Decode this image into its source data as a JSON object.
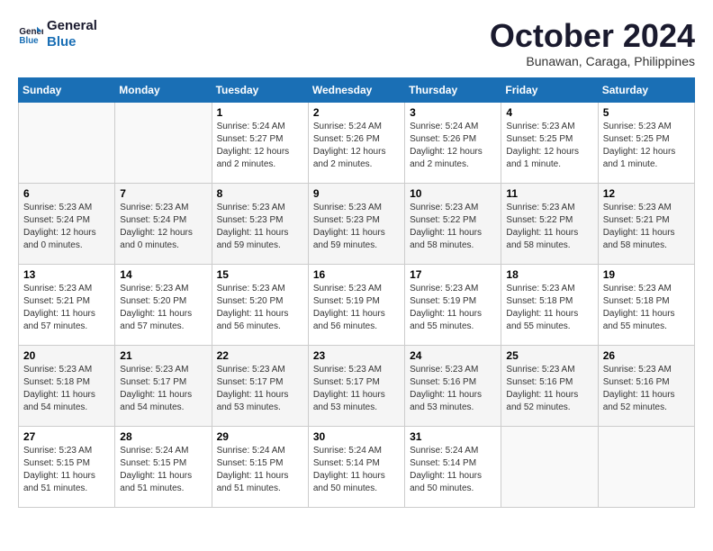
{
  "logo": {
    "line1": "General",
    "line2": "Blue"
  },
  "title": "October 2024",
  "location": "Bunawan, Caraga, Philippines",
  "headers": [
    "Sunday",
    "Monday",
    "Tuesday",
    "Wednesday",
    "Thursday",
    "Friday",
    "Saturday"
  ],
  "weeks": [
    [
      {
        "day": "",
        "info": ""
      },
      {
        "day": "",
        "info": ""
      },
      {
        "day": "1",
        "info": "Sunrise: 5:24 AM\nSunset: 5:27 PM\nDaylight: 12 hours and 2 minutes."
      },
      {
        "day": "2",
        "info": "Sunrise: 5:24 AM\nSunset: 5:26 PM\nDaylight: 12 hours and 2 minutes."
      },
      {
        "day": "3",
        "info": "Sunrise: 5:24 AM\nSunset: 5:26 PM\nDaylight: 12 hours and 2 minutes."
      },
      {
        "day": "4",
        "info": "Sunrise: 5:23 AM\nSunset: 5:25 PM\nDaylight: 12 hours and 1 minute."
      },
      {
        "day": "5",
        "info": "Sunrise: 5:23 AM\nSunset: 5:25 PM\nDaylight: 12 hours and 1 minute."
      }
    ],
    [
      {
        "day": "6",
        "info": "Sunrise: 5:23 AM\nSunset: 5:24 PM\nDaylight: 12 hours and 0 minutes."
      },
      {
        "day": "7",
        "info": "Sunrise: 5:23 AM\nSunset: 5:24 PM\nDaylight: 12 hours and 0 minutes."
      },
      {
        "day": "8",
        "info": "Sunrise: 5:23 AM\nSunset: 5:23 PM\nDaylight: 11 hours and 59 minutes."
      },
      {
        "day": "9",
        "info": "Sunrise: 5:23 AM\nSunset: 5:23 PM\nDaylight: 11 hours and 59 minutes."
      },
      {
        "day": "10",
        "info": "Sunrise: 5:23 AM\nSunset: 5:22 PM\nDaylight: 11 hours and 58 minutes."
      },
      {
        "day": "11",
        "info": "Sunrise: 5:23 AM\nSunset: 5:22 PM\nDaylight: 11 hours and 58 minutes."
      },
      {
        "day": "12",
        "info": "Sunrise: 5:23 AM\nSunset: 5:21 PM\nDaylight: 11 hours and 58 minutes."
      }
    ],
    [
      {
        "day": "13",
        "info": "Sunrise: 5:23 AM\nSunset: 5:21 PM\nDaylight: 11 hours and 57 minutes."
      },
      {
        "day": "14",
        "info": "Sunrise: 5:23 AM\nSunset: 5:20 PM\nDaylight: 11 hours and 57 minutes."
      },
      {
        "day": "15",
        "info": "Sunrise: 5:23 AM\nSunset: 5:20 PM\nDaylight: 11 hours and 56 minutes."
      },
      {
        "day": "16",
        "info": "Sunrise: 5:23 AM\nSunset: 5:19 PM\nDaylight: 11 hours and 56 minutes."
      },
      {
        "day": "17",
        "info": "Sunrise: 5:23 AM\nSunset: 5:19 PM\nDaylight: 11 hours and 55 minutes."
      },
      {
        "day": "18",
        "info": "Sunrise: 5:23 AM\nSunset: 5:18 PM\nDaylight: 11 hours and 55 minutes."
      },
      {
        "day": "19",
        "info": "Sunrise: 5:23 AM\nSunset: 5:18 PM\nDaylight: 11 hours and 55 minutes."
      }
    ],
    [
      {
        "day": "20",
        "info": "Sunrise: 5:23 AM\nSunset: 5:18 PM\nDaylight: 11 hours and 54 minutes."
      },
      {
        "day": "21",
        "info": "Sunrise: 5:23 AM\nSunset: 5:17 PM\nDaylight: 11 hours and 54 minutes."
      },
      {
        "day": "22",
        "info": "Sunrise: 5:23 AM\nSunset: 5:17 PM\nDaylight: 11 hours and 53 minutes."
      },
      {
        "day": "23",
        "info": "Sunrise: 5:23 AM\nSunset: 5:17 PM\nDaylight: 11 hours and 53 minutes."
      },
      {
        "day": "24",
        "info": "Sunrise: 5:23 AM\nSunset: 5:16 PM\nDaylight: 11 hours and 53 minutes."
      },
      {
        "day": "25",
        "info": "Sunrise: 5:23 AM\nSunset: 5:16 PM\nDaylight: 11 hours and 52 minutes."
      },
      {
        "day": "26",
        "info": "Sunrise: 5:23 AM\nSunset: 5:16 PM\nDaylight: 11 hours and 52 minutes."
      }
    ],
    [
      {
        "day": "27",
        "info": "Sunrise: 5:23 AM\nSunset: 5:15 PM\nDaylight: 11 hours and 51 minutes."
      },
      {
        "day": "28",
        "info": "Sunrise: 5:24 AM\nSunset: 5:15 PM\nDaylight: 11 hours and 51 minutes."
      },
      {
        "day": "29",
        "info": "Sunrise: 5:24 AM\nSunset: 5:15 PM\nDaylight: 11 hours and 51 minutes."
      },
      {
        "day": "30",
        "info": "Sunrise: 5:24 AM\nSunset: 5:14 PM\nDaylight: 11 hours and 50 minutes."
      },
      {
        "day": "31",
        "info": "Sunrise: 5:24 AM\nSunset: 5:14 PM\nDaylight: 11 hours and 50 minutes."
      },
      {
        "day": "",
        "info": ""
      },
      {
        "day": "",
        "info": ""
      }
    ]
  ]
}
